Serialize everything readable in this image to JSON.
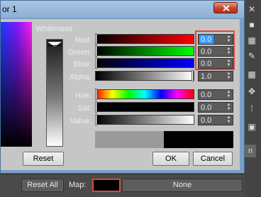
{
  "window": {
    "title": "or 1"
  },
  "whiteness": {
    "label": "Whiteness"
  },
  "channels": {
    "red": {
      "label": "Red:",
      "value": "0.0"
    },
    "green": {
      "label": "Green:",
      "value": "0.0"
    },
    "blue": {
      "label": "Blue:",
      "value": "0.0"
    },
    "alpha": {
      "label": "Alpha:",
      "value": "1.0"
    },
    "hue": {
      "label": "Hue:",
      "value": "0.0"
    },
    "sat": {
      "label": "Sat:",
      "value": "0.0"
    },
    "value": {
      "label": "Value:",
      "value": "0.0"
    }
  },
  "buttons": {
    "reset": "Reset",
    "ok": "OK",
    "cancel": "Cancel"
  },
  "background": {
    "reset_all": "Reset All",
    "map_label": "Map:",
    "map_value": "None",
    "edge_tab": "n"
  },
  "colors": {
    "highlight": "#e0453a",
    "selection": "#3399ff",
    "current_color": "#000000",
    "original_color": "#9a9a9a"
  }
}
